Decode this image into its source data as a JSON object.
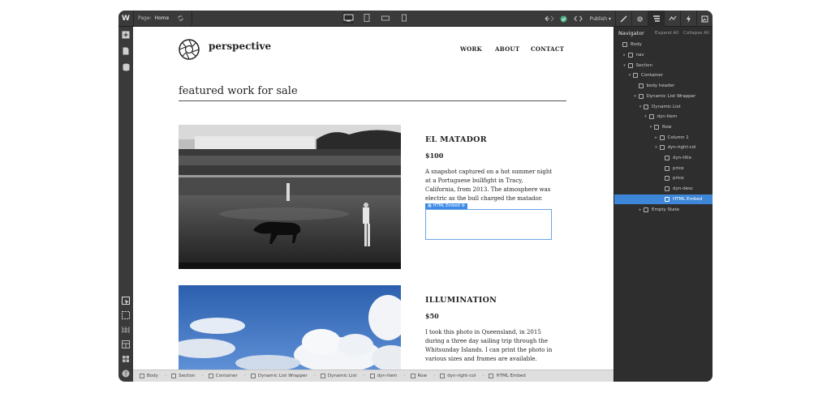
{
  "topbar": {
    "logo": "W",
    "page_label": "Page:",
    "page_name": "Home",
    "publish_label": "Publish",
    "icons": [
      "webflow-logo",
      "page-switch-icon",
      "desktop-icon",
      "tablet-icon",
      "mobile-landscape-icon",
      "mobile-portrait-icon",
      "undo-redo-icon",
      "check-icon",
      "code-icon",
      "style-brush-icon",
      "settings-gear-icon",
      "navigator-icon",
      "interactions-icon",
      "lightning-icon",
      "assets-icon"
    ]
  },
  "lefttools": [
    "add-icon",
    "pages-icon",
    "cms-icon",
    "select-icon",
    "dashed-select-icon",
    "grid-icon",
    "layout-icon",
    "components-icon",
    "help-icon"
  ],
  "site": {
    "brand": "perspective",
    "nav": [
      "WORK",
      "ABOUT",
      "CONTACT"
    ],
    "section_title": "featured work for sale",
    "items": [
      {
        "title": "EL MATADOR",
        "price": "$100",
        "description": "A snapshot captured on a hot summer night at a Portuguese bullfight in Tracy, California, from 2013. The atmosphere was electric as the bull charged the matador."
      },
      {
        "title": "ILLUMINATION",
        "price": "$50",
        "description": "I took this photo in Queensland, in 2015 during a three day sailing trip through the Whitsunday Islands. I can print the photo in various sizes and frames are available."
      }
    ],
    "embed_label": "HTML Embed"
  },
  "breadcrumbs": [
    "Body",
    "Section",
    "Container",
    "Dynamic List Wrapper",
    "Dynamic List",
    "dyn-item",
    "Row",
    "dyn-right-col",
    "HTML Embed"
  ],
  "navigator": {
    "title": "Navigator",
    "expand_all": "Expand All",
    "collapse_all": "Collapse All",
    "nodes": [
      {
        "label": "Body",
        "depth": 0,
        "caret": ""
      },
      {
        "label": "nav",
        "depth": 1,
        "caret": "▸"
      },
      {
        "label": "Section",
        "depth": 1,
        "caret": "▾"
      },
      {
        "label": "Container",
        "depth": 2,
        "caret": "▾"
      },
      {
        "label": "body header",
        "depth": 3,
        "caret": ""
      },
      {
        "label": "Dynamic List Wrapper",
        "depth": 3,
        "caret": "▾"
      },
      {
        "label": "Dynamic List",
        "depth": 4,
        "caret": "▾"
      },
      {
        "label": "dyn-item",
        "depth": 5,
        "caret": "▾"
      },
      {
        "label": "Row",
        "depth": 6,
        "caret": "▾"
      },
      {
        "label": "Column 1",
        "depth": 7,
        "caret": "▸"
      },
      {
        "label": "dyn-right-col",
        "depth": 7,
        "caret": "▾"
      },
      {
        "label": "dyn-title",
        "depth": 8,
        "caret": ""
      },
      {
        "label": "price",
        "depth": 8,
        "caret": ""
      },
      {
        "label": "price",
        "depth": 8,
        "caret": ""
      },
      {
        "label": "dyn-desc",
        "depth": 8,
        "caret": ""
      },
      {
        "label": "HTML Embed",
        "depth": 8,
        "caret": "",
        "selected": true
      },
      {
        "label": "Empty State",
        "depth": 4,
        "caret": "▸"
      }
    ]
  },
  "colors": {
    "chrome_dark": "#2b2b2b",
    "chrome_mid": "#3a3a3a",
    "selection_blue": "#3e86d8",
    "embed_blue": "#3e8be6"
  }
}
